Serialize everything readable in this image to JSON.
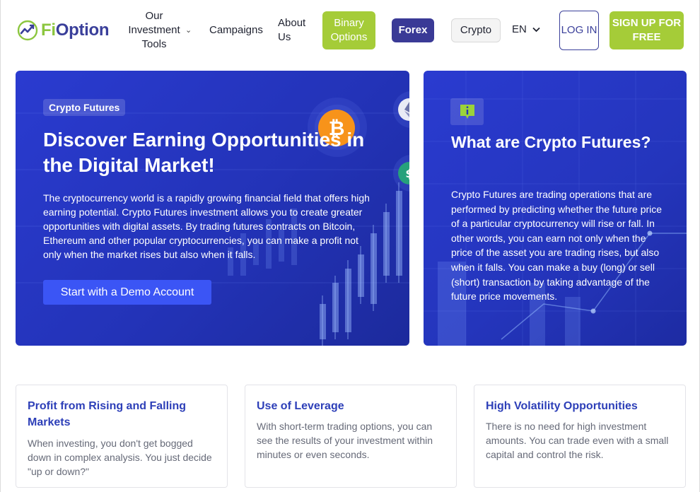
{
  "brand": {
    "logo_fi": "Fi",
    "logo_option": "Option",
    "accent": "#a5cc38",
    "primary": "#3a3f9a"
  },
  "nav": {
    "investment_tools": "Our Investment Tools",
    "campaigns": "Campaigns",
    "about": "About Us",
    "binary_options": "Binary Options",
    "forex": "Forex",
    "crypto": "Crypto",
    "language": "EN",
    "login": "LOG IN",
    "signup": "SIGN UP FOR FREE"
  },
  "hero": {
    "badge": "Crypto Futures",
    "title": "Discover Earning Opportunities in the Digital Market!",
    "description": "The cryptocurrency world is a rapidly growing financial field that offers high earning potential. Crypto Futures investment allows you to create greater opportunities with digital assets. By trading futures contracts on Bitcoin, Ethereum and other popular cryptocurrencies, you can make a profit not only when the market rises but also when it falls.",
    "cta": "Start with a Demo Account"
  },
  "info": {
    "icon": "info-icon",
    "title": "What are Crypto Futures?",
    "description": "Crypto Futures are trading operations that are performed by predicting whether the future price of a particular cryptocurrency will rise or fall. In other words, you can earn not only when the price of the asset you are trading rises, but also when it falls. You can make a buy (long) or sell (short) transaction by taking advantage of the future price movements."
  },
  "features": [
    {
      "title": "Profit from Rising and Falling Markets",
      "text": "When investing, you don't get bogged down in complex analysis. You just decide \"up or down?\""
    },
    {
      "title": "Use of Leverage",
      "text": "With short-term trading options, you can see the results of your investment within minutes or even seconds."
    },
    {
      "title": "High Volatility Opportunities",
      "text": "There is no need for high investment amounts. You can trade even with a small capital and control the risk."
    }
  ]
}
